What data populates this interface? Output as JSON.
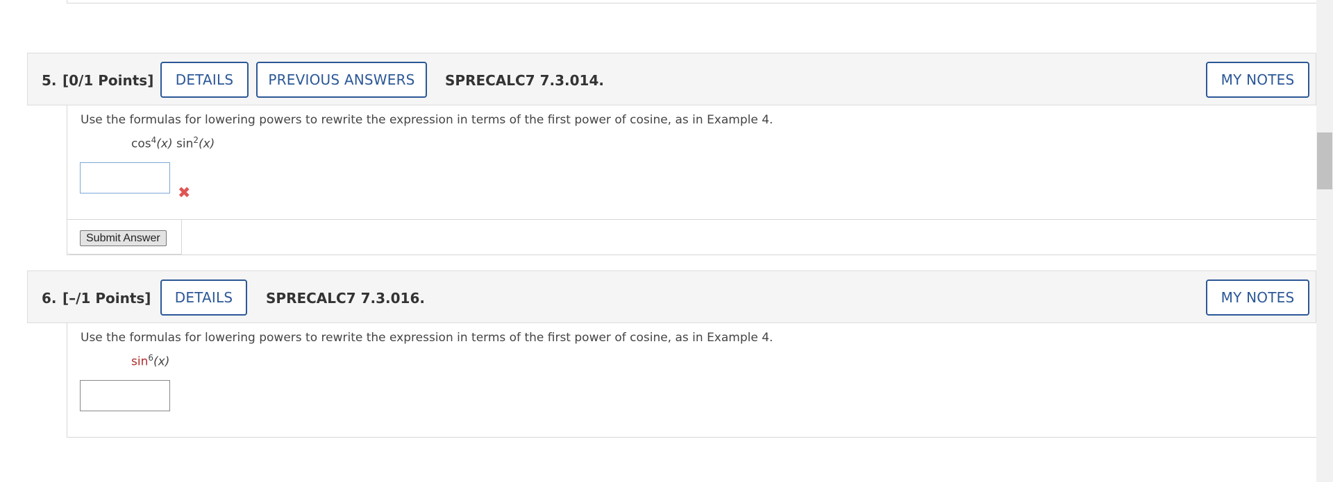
{
  "questions": [
    {
      "number": "5.",
      "points": "[0/1 Points]",
      "details_label": "DETAILS",
      "previous_answers_label": "PREVIOUS ANSWERS",
      "code": "SPRECALC7 7.3.014.",
      "my_notes_label": "MY NOTES",
      "prompt": "Use the formulas for lowering powers to rewrite the expression in terms of the first power of cosine, as in Example 4.",
      "expression": {
        "f1": "cos",
        "p1": "4",
        "arg1": "(x)",
        "f2": "sin",
        "p2": "2",
        "arg2": "(x)"
      },
      "answer_value": "",
      "status_icon": "x-mark-icon",
      "submit_label": "Submit Answer"
    },
    {
      "number": "6.",
      "points": "[–/1 Points]",
      "details_label": "DETAILS",
      "code": "SPRECALC7 7.3.016.",
      "my_notes_label": "MY NOTES",
      "prompt": "Use the formulas for lowering powers to rewrite the expression in terms of the first power of cosine, as in Example 4.",
      "expression": {
        "f1": "sin",
        "p1": "6",
        "arg1": "(x)"
      },
      "answer_value": ""
    }
  ],
  "colors": {
    "accent": "#2b5797",
    "header_bg": "#f5f5f5",
    "wrong": "#e05555",
    "highlight_fn": "#b02a2a"
  }
}
